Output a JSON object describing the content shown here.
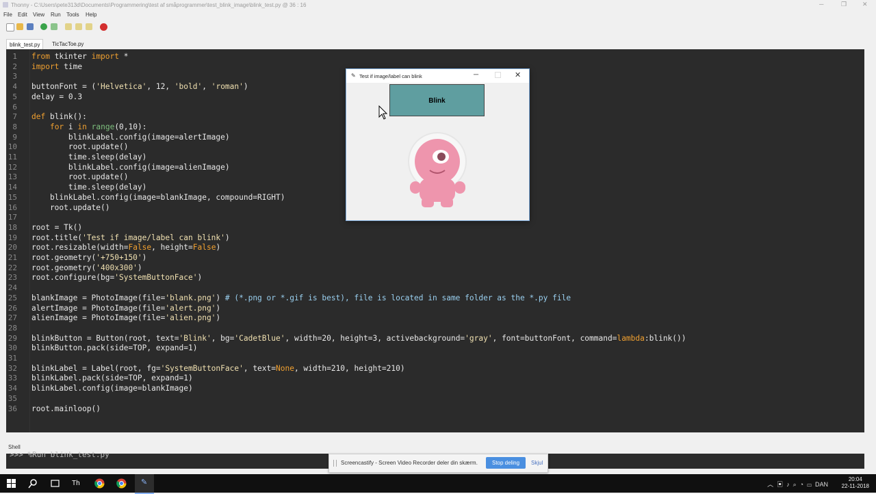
{
  "window": {
    "title": "Thonny  -  C:\\Users\\pete313d\\Documents\\Programmering\\test af småprogrammer\\test_blink_image\\blink_test.py  @  36 : 16"
  },
  "menu": [
    "File",
    "Edit",
    "View",
    "Run",
    "Tools",
    "Help"
  ],
  "toolbar_icons": [
    "new-file-icon",
    "open-file-icon",
    "save-icon",
    "run-icon",
    "debug-icon",
    "step-over-icon",
    "step-into-icon",
    "step-out-icon",
    "stop-icon"
  ],
  "tabs": [
    {
      "label": "blink_test.py",
      "active": true
    },
    {
      "label": "TicTacToe.py",
      "active": false
    }
  ],
  "editor": {
    "line_numbers": [
      "1",
      "2",
      "3",
      "4",
      "5",
      "6",
      "7",
      "8",
      "9",
      "10",
      "11",
      "12",
      "13",
      "14",
      "15",
      "16",
      "17",
      "18",
      "19",
      "20",
      "21",
      "22",
      "23",
      "24",
      "25",
      "26",
      "27",
      "28",
      "29",
      "30",
      "31",
      "32",
      "33",
      "34",
      "35",
      "36"
    ],
    "lines": [
      "from tkinter import *",
      "import time",
      "",
      "buttonFont = ('Helvetica', 12, 'bold', 'roman')",
      "delay = 0.3",
      "",
      "def blink():",
      "    for i in range(0,10):",
      "        blinkLabel.config(image=alertImage)",
      "        root.update()",
      "        time.sleep(delay)",
      "        blinkLabel.config(image=alienImage)",
      "        root.update()",
      "        time.sleep(delay)",
      "    blinkLabel.config(image=blankImage, compound=RIGHT)",
      "    root.update()",
      "",
      "root = Tk()",
      "root.title('Test if image/label can blink')",
      "root.resizable(width=False, height=False)",
      "root.geometry('+750+150')",
      "root.geometry('400x300')",
      "root.configure(bg='SystemButtonFace')",
      "",
      "blankImage = PhotoImage(file='blank.png') # (*.png or *.gif is best), file is located in same folder as the *.py file",
      "alertImage = PhotoImage(file='alert.png')",
      "alienImage = PhotoImage(file='alien.png')",
      "",
      "blinkButton = Button(root, text='Blink', bg='CadetBlue', width=20, height=3, activebackground='gray', font=buttonFont, command=lambda:blink())",
      "blinkButton.pack(side=TOP, expand=1)",
      "",
      "blinkLabel = Label(root, fg='SystemButtonFace', text=None, width=210, height=210)",
      "blinkLabel.pack(side=TOP, expand=1)",
      "blinkLabel.config(image=blankImage)",
      "",
      "root.mainloop()"
    ]
  },
  "shell": {
    "tab_label": "Shell",
    "text": ">>> %Run blink_test.py"
  },
  "tk_window": {
    "title": "Test if image/label can blink",
    "button_label": "Blink",
    "button_color": "#5f9ea0"
  },
  "screencastify": {
    "message": "Screencastify - Screen Video Recorder deler din skærm.",
    "stop_label": "Stop deling",
    "hide_label": "Skjul"
  },
  "taskbar": {
    "language": "DAN",
    "time": "20:04",
    "date": "22-11-2018"
  },
  "colors": {
    "editor_bg": "#2b2b2b",
    "keyword": "#f0a030",
    "string": "#f0e0b0",
    "builtin": "#7ec07e",
    "comment": "#9ad0f0"
  }
}
